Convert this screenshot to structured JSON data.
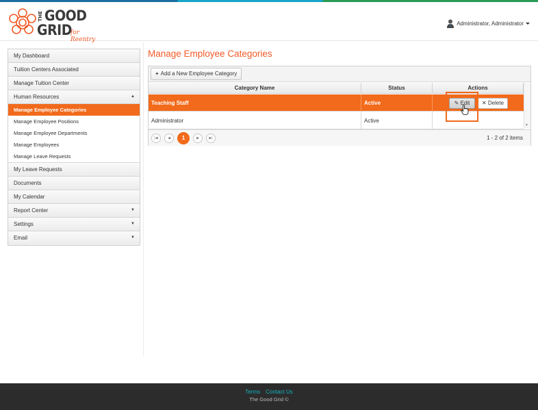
{
  "header": {
    "logo": {
      "the": "THE",
      "good": "GOOD",
      "grid": "GRID",
      "tagline": "for Reentry"
    },
    "user_label": "Administrator, Administrator"
  },
  "sidebar": {
    "items": [
      {
        "label": "My Dashboard"
      },
      {
        "label": "Tuition Centers Associated"
      },
      {
        "label": "Manage Tuition Center"
      },
      {
        "label": "Human Resources",
        "arrow": "▲"
      },
      {
        "label": "My Leave Requests"
      },
      {
        "label": "Documents"
      },
      {
        "label": "My Calendar"
      },
      {
        "label": "Report Center",
        "arrow": "▼"
      },
      {
        "label": "Settings",
        "arrow": "▼"
      },
      {
        "label": "Email",
        "arrow": "▼"
      }
    ],
    "sub_items": [
      {
        "label": "Manage Employee Categories",
        "active": true
      },
      {
        "label": "Manage Employee Positions"
      },
      {
        "label": "Manage Employee Departments"
      },
      {
        "label": "Manage Employees"
      },
      {
        "label": "Manage Leave Requests"
      }
    ]
  },
  "main": {
    "title": "Manage Employee Categories",
    "add_button": "Add a New Employee Category",
    "columns": [
      "Category Name",
      "Status",
      "Actions"
    ],
    "rows": [
      {
        "name": "Teaching Staff",
        "status": "Active",
        "selected": true
      },
      {
        "name": "Administrator",
        "status": "Active",
        "selected": false
      }
    ],
    "edit_label": "Edit",
    "delete_label": "Delete",
    "pager": {
      "current_page": "1",
      "info": "1 - 2 of 2 items"
    }
  },
  "footer": {
    "links": [
      "Terms",
      "Contact Us"
    ],
    "copyright": "The Good Grid ©"
  },
  "colors": {
    "accent": "#f26a1b",
    "footer_bg": "#2c2c2c",
    "link": "#16b3c2"
  }
}
